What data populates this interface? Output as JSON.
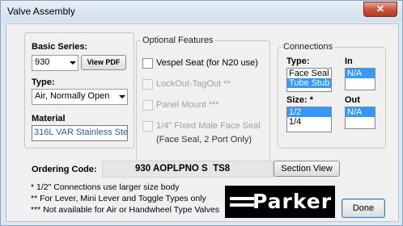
{
  "window": {
    "title": "Valve Assembly",
    "close_glyph": "✕"
  },
  "basic_series": {
    "label": "Basic Series:",
    "value": "930",
    "view_pdf_label": "View PDF"
  },
  "type_field": {
    "label": "Type:",
    "value": "Air, Normally Open"
  },
  "material": {
    "label": "Material",
    "value": "316L VAR Stainless Stee"
  },
  "optional_features": {
    "title": "Optional Features",
    "items": [
      {
        "label": "Vespel Seat (for N20 use)",
        "checked": false,
        "enabled": true
      },
      {
        "label": "LockOut-TagOut **",
        "checked": false,
        "enabled": false
      },
      {
        "label": "Panel Mount ***",
        "checked": false,
        "enabled": false
      },
      {
        "label": "1/4\" Fixed Male Face Seal",
        "checked": false,
        "enabled": false
      }
    ],
    "note": "(Face Seal, 2 Port Only)"
  },
  "connections": {
    "title": "Connections",
    "type_label": "Type:",
    "in_label": "In",
    "size_label": "Size: *",
    "out_label": "Out",
    "type_options": [
      "Face Seal",
      "Tube Stub"
    ],
    "type_selected": "Tube Stub",
    "in_options": [
      "N/A"
    ],
    "in_selected": "N/A",
    "size_options": [
      "1/2",
      "1/4"
    ],
    "size_selected": "1/2",
    "out_options": [
      "N/A"
    ],
    "out_selected": "N/A"
  },
  "ordering_code": {
    "label": "Ordering Code:",
    "value": "930 AOPLPNO S  TS8"
  },
  "section_view_label": "Section View",
  "footnotes": [
    "* 1/2\" Connections use larger size body",
    "** For Lever, Mini Lever and Toggle Types only",
    "*** Not available for Air or Handwheel Type Valves"
  ],
  "logo_text": "Parker",
  "done_label": "Done",
  "colors": {
    "selection": "#3399ff",
    "close_button": "#c7533c"
  }
}
